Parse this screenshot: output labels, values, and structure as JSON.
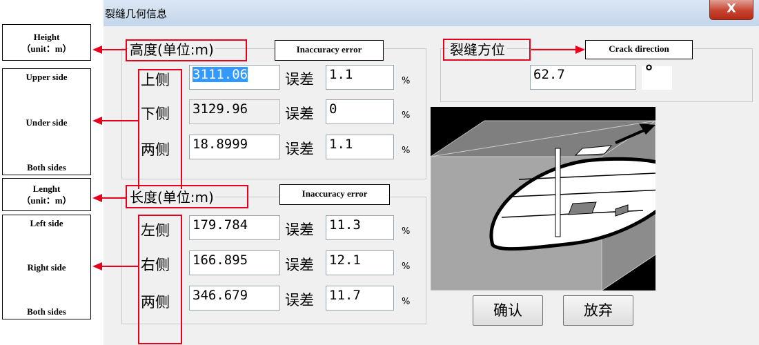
{
  "dialog": {
    "title": "裂缝几何信息",
    "close_glyph": "X"
  },
  "annotations": {
    "height_group": {
      "line1": "Height",
      "line2": "（unit：m）"
    },
    "height_rows": {
      "top": "Upper side",
      "middle": "Under side",
      "bottom": "Both sides"
    },
    "length_group": {
      "line1": "Lenght",
      "line2": "（unit：m）"
    },
    "length_rows": {
      "top": "Left side",
      "middle": "Right side",
      "bottom": "Both sides"
    },
    "error_tag_1": "Inaccuracy error",
    "error_tag_2": "Inaccuracy error",
    "crack_tag": "Crack direction"
  },
  "height": {
    "label": "高度(单位:m)",
    "rows": [
      {
        "label": "上侧",
        "value": "3111.06",
        "err_label": "误差",
        "err": "1.1",
        "unit": "%"
      },
      {
        "label": "下侧",
        "value": "3129.96",
        "err_label": "误差",
        "err": "0",
        "unit": "%"
      },
      {
        "label": "两侧",
        "value": "18.8999",
        "err_label": "误差",
        "err": "1.1",
        "unit": "%"
      }
    ]
  },
  "length": {
    "label": "长度(单位:m)",
    "rows": [
      {
        "label": "左侧",
        "value": "179.784",
        "err_label": "误差",
        "err": "11.3",
        "unit": "%"
      },
      {
        "label": "右侧",
        "value": "166.895",
        "err_label": "误差",
        "err": "12.1",
        "unit": "%"
      },
      {
        "label": "两侧",
        "value": "346.679",
        "err_label": "误差",
        "err": "11.7",
        "unit": "%"
      }
    ]
  },
  "crack": {
    "label": "裂缝方位",
    "value": "62.7",
    "unit": "°"
  },
  "buttons": {
    "confirm": "确认",
    "cancel": "放弃"
  },
  "colors": {
    "highlight_red": "#e8001c",
    "selection_blue": "#3399ff"
  },
  "icons": {
    "preview": "fracture-3d-diagram",
    "close": "close-icon"
  }
}
